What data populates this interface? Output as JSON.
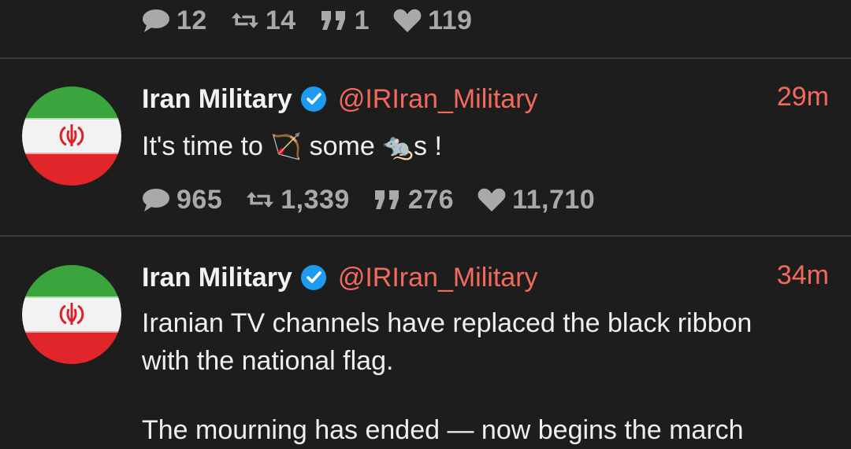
{
  "top_tweet": {
    "stats": {
      "replies": "12",
      "retweets": "14",
      "quotes": "1",
      "likes": "119"
    }
  },
  "tweets": [
    {
      "name": "Iran Military",
      "handle": "@IRIran_Military",
      "time": "29m",
      "text_before": "It's time to ",
      "emoji_1": "🏹",
      "text_middle": " some ",
      "emoji_2": "🐀",
      "text_after": "s !",
      "stats": {
        "replies": "965",
        "retweets": "1,339",
        "quotes": "276",
        "likes": "11,710"
      }
    },
    {
      "name": "Iran Military",
      "handle": "@IRIran_Military",
      "time": "34m",
      "text": "Iranian TV channels have replaced the black ribbon\nwith the national flag.",
      "text_2": "The mourning has ended — now begins the march"
    }
  ],
  "colors": {
    "accent": "#f26a5e",
    "verified": "#1d9bf0",
    "stat": "#a9a9a9",
    "background": "#1d1d1d"
  },
  "icons": {
    "reply": "speech-bubble-icon",
    "retweet": "retweet-icon",
    "quote": "quote-icon",
    "like": "heart-icon",
    "verified": "verified-badge-icon"
  }
}
